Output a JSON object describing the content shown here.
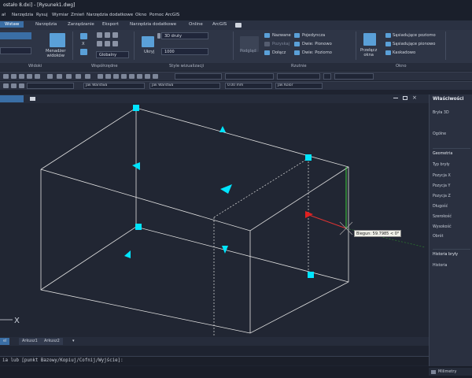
{
  "titlebar": {
    "title": "ostało 8.dxi] - [Rysunek1.dwg]"
  },
  "menu": [
    "ał",
    "Narzędzia",
    "Rysuj",
    "Wymiar",
    "Zmień",
    "Narzędzia dodatkowe",
    "Okno",
    "Pomoc",
    "ArcGIS"
  ],
  "ribbon_tabs": [
    "Wstaw",
    "Narzędzia",
    "Zarządzanie",
    "Eksport",
    "Narzędzia dodatkowe",
    "Online",
    "ArcGIS"
  ],
  "ribbon": {
    "menadzer": "Menadżer\nwidoków",
    "globalny": "Globalny",
    "visual_style": "3D druty",
    "ukryj": "Ukryj",
    "value_1000": "1000",
    "podglad": "Podgląd",
    "nazwane": "Nazwane",
    "pozyskaj": "Pozyskaj",
    "dolacz": "Dołącz",
    "pojedyncza": "Pojedyncza",
    "dwie_pionowo": "Dwie: Pionowo",
    "dwie_poziomo": "Dwie: Poziomo",
    "przelacz_okna": "Przełącz\nokna",
    "sasiadujace_poziomo": "Sąsiadujące poziomo",
    "sasiadujace_pionowo": "Sąsiadujące pionowo",
    "kaskadowo": "Kaskadowo"
  },
  "ribbon_groups": [
    "Widoki",
    "Współrzędne",
    "Style wizualizacji",
    "Rzutnie",
    "Okno"
  ],
  "toolbar2": {
    "layer": "Jak Warstwa",
    "linetype": "Jak Warstwa",
    "lineweight": "0.00 mm",
    "color": "Jak Kolor"
  },
  "doc_tabs": [
    ""
  ],
  "viewport": {
    "axis_label": "X",
    "tooltip": "Biegun: 59.7985 < 0°"
  },
  "panel": {
    "title": "Właściwości",
    "object": "Bryła 3D",
    "general": "Ogólne",
    "geometry": "Geometria",
    "geometry_items": [
      "Typ bryły",
      "Pozycja X",
      "Pozycja Y",
      "Pozycja Z",
      "Długość",
      "Szerokość",
      "Wysokość",
      "Obrót"
    ],
    "history_section": "Historia bryły",
    "history": "Historia"
  },
  "layout_tabs": [
    "el",
    "Arkusz1",
    "Arkusz2"
  ],
  "command": {
    "text": "ia lub [punkt Bazowy/Kopiuj/Cofnij/Wyjście]:"
  },
  "status": {
    "units": "Milimetry"
  },
  "colors": {
    "accent": "#3a6ea5",
    "grip": "#00e5ff",
    "wire": "#e8e8e8"
  }
}
